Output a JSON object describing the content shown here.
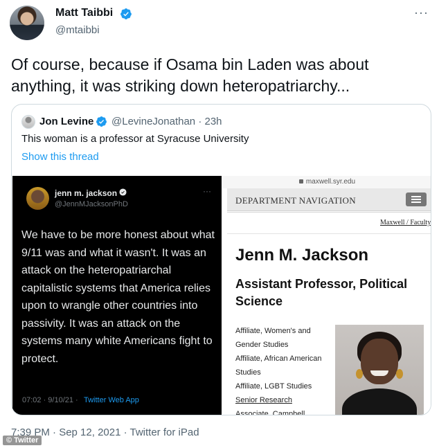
{
  "tweet": {
    "author": {
      "name": "Matt Taibbi",
      "handle": "@mtaibbi",
      "verified_icon": "verified-badge-icon"
    },
    "more_icon": "···",
    "text": "Of course, because if Osama bin Laden was about anything, it was striking down heteropatriarchy...",
    "meta": "7:39 PM · Sep 12, 2021 · Twitter for iPad"
  },
  "quote": {
    "author": {
      "name": "Jon Levine",
      "handle": "@LevineJonathan · 23h"
    },
    "text": "This woman is a professor at Syracuse University",
    "show_thread": "Show this thread",
    "image_left": {
      "name": "jenn m. jackson",
      "handle": "@JennMJacksonPhD",
      "more": "···",
      "text": "We have to be more honest about what 9/11 was and what it wasn't. It was an attack on the heteropatriarchal capitalistic systems that America relies upon to wrangle other countries into passivity. It was an attack on the systems many white Americans fight to protect.",
      "time": "07:02 · 9/10/21 ·",
      "app": "Twitter Web App"
    },
    "image_right": {
      "url": "maxwell.syr.edu",
      "nav_label": "DEPARTMENT NAVIGATION",
      "breadcrumb": "Maxwell / Faculty",
      "name": "Jenn M. Jackson",
      "title": "Assistant Professor, Political Science",
      "affiliations": [
        "Affiliate, Women's and Gender Studies",
        "Affiliate, African American Studies",
        "Affiliate, LGBT Studies"
      ],
      "senior_link": "Senior Research",
      "cut_line": "Associate, Campbell"
    }
  },
  "watermark": "© Twitter",
  "colors": {
    "accent": "#1d9bf0",
    "text": "#0f1419",
    "muted": "#536471",
    "border": "#cfd9de"
  }
}
